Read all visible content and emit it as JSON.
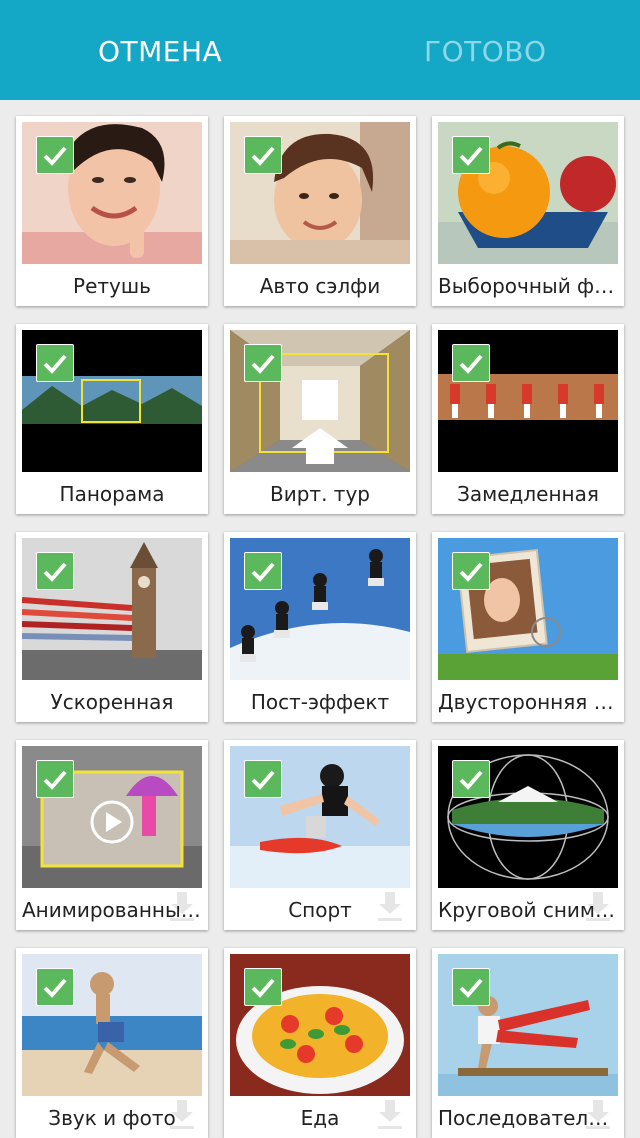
{
  "header": {
    "cancel_label": "ОТМЕНА",
    "done_label": "ГОТОВО"
  },
  "modes": [
    {
      "label": "Ретушь",
      "checked": true,
      "download": false
    },
    {
      "label": "Авто сэлфи",
      "checked": true,
      "download": false
    },
    {
      "label": "Выборочный фокус",
      "checked": true,
      "download": false
    },
    {
      "label": "Панорама",
      "checked": true,
      "download": false
    },
    {
      "label": "Вирт. тур",
      "checked": true,
      "download": false
    },
    {
      "label": "Замедленная",
      "checked": true,
      "download": false
    },
    {
      "label": "Ускоренная",
      "checked": true,
      "download": false
    },
    {
      "label": "Пост-эффект",
      "checked": true,
      "download": false
    },
    {
      "label": "Двусторонняя съемка",
      "checked": true,
      "download": false
    },
    {
      "label": "Анимированный GIF",
      "checked": true,
      "download": true
    },
    {
      "label": "Спорт",
      "checked": true,
      "download": true
    },
    {
      "label": "Круговой снимок",
      "checked": true,
      "download": true
    },
    {
      "label": "Звук и фото",
      "checked": true,
      "download": true
    },
    {
      "label": "Еда",
      "checked": true,
      "download": true
    },
    {
      "label": "Последовательная съемка",
      "checked": true,
      "download": true
    }
  ],
  "colors": {
    "header_bg": "#14a7c6",
    "check_bg": "#5cb85c",
    "done_text": "#8fd6e6"
  },
  "icons": {
    "check": "check-icon",
    "download": "download-icon"
  }
}
